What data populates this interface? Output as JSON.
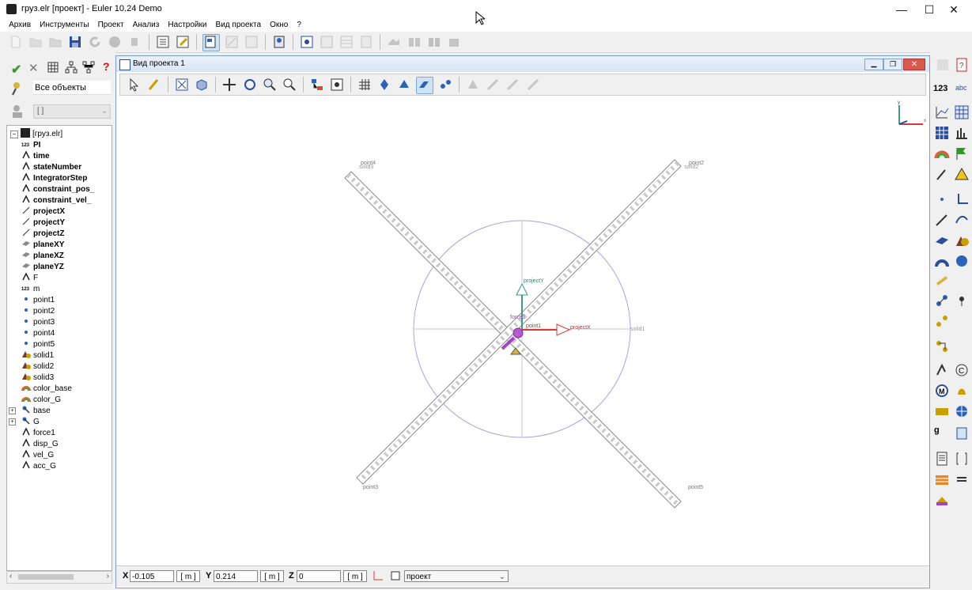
{
  "window": {
    "title": "груз.elr [проект] - Euler 10.24 Demo",
    "minimize": "—",
    "maximize": "☐",
    "close": "✕"
  },
  "menu": [
    "Архив",
    "Инструменты",
    "Проект",
    "Анализ",
    "Настройки",
    "Вид проекта",
    "Окно",
    "?"
  ],
  "left": {
    "filter_label": "Все объекты",
    "combo_value": "[ ]",
    "tree_root": "[груз.elr]",
    "tree_items": [
      {
        "label": "PI",
        "bold": true,
        "icon": "number-icon"
      },
      {
        "label": "time",
        "bold": true,
        "icon": "variable-icon"
      },
      {
        "label": "stateNumber",
        "bold": true,
        "icon": "variable-icon"
      },
      {
        "label": "IntegratorStep",
        "bold": true,
        "icon": "variable-icon"
      },
      {
        "label": "constraint_pos_",
        "bold": true,
        "icon": "variable-icon"
      },
      {
        "label": "constraint_vel_",
        "bold": true,
        "icon": "variable-icon"
      },
      {
        "label": "projectX",
        "bold": true,
        "icon": "vector-icon"
      },
      {
        "label": "projectY",
        "bold": true,
        "icon": "vector-icon"
      },
      {
        "label": "projectZ",
        "bold": true,
        "icon": "vector-icon"
      },
      {
        "label": "planeXY",
        "bold": true,
        "icon": "plane-icon"
      },
      {
        "label": "planeXZ",
        "bold": true,
        "icon": "plane-icon"
      },
      {
        "label": "planeYZ",
        "bold": true,
        "icon": "plane-icon"
      },
      {
        "label": "F",
        "bold": false,
        "icon": "variable-icon"
      },
      {
        "label": "m",
        "bold": false,
        "icon": "number-icon"
      },
      {
        "label": "point1",
        "bold": false,
        "icon": "point-icon"
      },
      {
        "label": "point2",
        "bold": false,
        "icon": "point-icon"
      },
      {
        "label": "point3",
        "bold": false,
        "icon": "point-icon"
      },
      {
        "label": "point4",
        "bold": false,
        "icon": "point-icon"
      },
      {
        "label": "point5",
        "bold": false,
        "icon": "point-icon"
      },
      {
        "label": "solid1",
        "bold": false,
        "icon": "solid-icon"
      },
      {
        "label": "solid2",
        "bold": false,
        "icon": "solid-icon"
      },
      {
        "label": "solid3",
        "bold": false,
        "icon": "solid-icon"
      },
      {
        "label": "color_base",
        "bold": false,
        "icon": "rainbow-icon"
      },
      {
        "label": "color_G",
        "bold": false,
        "icon": "rainbow-icon"
      },
      {
        "label": "base",
        "bold": false,
        "icon": "body-icon",
        "expandable": true
      },
      {
        "label": "G",
        "bold": false,
        "icon": "body-icon",
        "expandable": true
      },
      {
        "label": "force1",
        "bold": false,
        "icon": "variable-icon"
      },
      {
        "label": "disp_G",
        "bold": false,
        "icon": "variable-icon"
      },
      {
        "label": "vel_G",
        "bold": false,
        "icon": "variable-icon"
      },
      {
        "label": "acc_G",
        "bold": false,
        "icon": "variable-icon"
      }
    ]
  },
  "view": {
    "title": "Вид проекта 1",
    "labels": {
      "point1": "point1",
      "point2": "point2",
      "point3": "point3",
      "point4": "point4",
      "point5": "point5",
      "solid1": "solid1",
      "solid2": "solid2",
      "solid3": "solid3",
      "projectX": "projectX",
      "projectY": "projectY",
      "force1": "force1",
      "axis_x": "x",
      "axis_y": "y"
    },
    "colors": {
      "circle": "#a7a3e0",
      "bar": "#7f7f7f",
      "x_arrow": "#d23b3b",
      "y_arrow": "#3c9a86",
      "force": "#a540c8"
    }
  },
  "coords": {
    "x_label": "X",
    "x_value": "-0.105",
    "x_unit": "[ m ]",
    "y_label": "Y",
    "y_value": "0.214",
    "y_unit": "[ m ]",
    "z_label": "Z",
    "z_value": "0",
    "z_unit": "[ m ]",
    "frame_value": "проект"
  },
  "right_toolbar": {
    "label_123": "123",
    "label_abc": "abc",
    "label_ig": "g"
  }
}
